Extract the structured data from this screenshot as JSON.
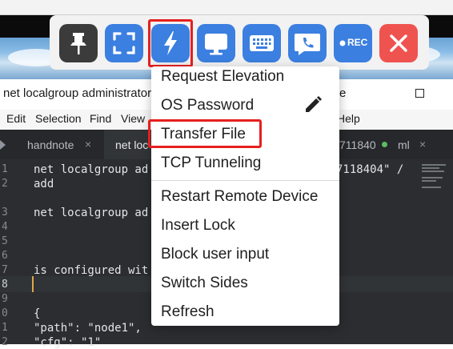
{
  "window": {
    "title": "net localgroup administrators",
    "title_suffix": "e"
  },
  "menubar": {
    "items": [
      "Edit",
      "Selection",
      "Find",
      "View",
      "Help"
    ]
  },
  "tabs": [
    {
      "label": "handnote",
      "close": "×"
    },
    {
      "label": "net loc",
      "active": true
    },
    {
      "label": "711840"
    },
    {
      "label": "ml",
      "close": "×"
    }
  ],
  "editor": {
    "lines": [
      {
        "no": "1",
        "text": "net localgroup ad",
        "tail": "7118404\" /"
      },
      {
        "no": "2",
        "text": "add"
      },
      {
        "no": "3",
        "text": "net localgroup ad"
      },
      {
        "no": "4",
        "text": ""
      },
      {
        "no": "5",
        "text": ""
      },
      {
        "no": "6",
        "text": ""
      },
      {
        "no": "7",
        "text": "is configured wit"
      },
      {
        "no": "8",
        "text": ""
      },
      {
        "no": "9",
        "text": ""
      },
      {
        "no": "0",
        "text": "{"
      },
      {
        "no": "1",
        "text": "\"path\": \"node1\","
      },
      {
        "no": "2",
        "text": "\"cfg\": \"1\""
      }
    ]
  },
  "toolbar": {
    "buttons": [
      {
        "name": "pin",
        "icon": "pin-icon"
      },
      {
        "name": "fullscreen",
        "icon": "fullscreen-icon"
      },
      {
        "name": "actions",
        "icon": "lightning-icon"
      },
      {
        "name": "display",
        "icon": "monitor-icon"
      },
      {
        "name": "keyboard",
        "icon": "keyboard-icon"
      },
      {
        "name": "call",
        "icon": "phone-chat-icon"
      },
      {
        "name": "record",
        "icon": "record-icon",
        "label": "REC"
      },
      {
        "name": "close",
        "icon": "close-icon"
      }
    ],
    "record_label": "REC"
  },
  "dropdown": {
    "items": [
      "Request Elevation",
      "OS Password",
      "Transfer File",
      "TCP Tunneling",
      "Restart Remote Device",
      "Insert Lock",
      "Block user input",
      "Switch Sides",
      "Refresh"
    ]
  },
  "colors": {
    "toolbar_button": "#3b7fe0",
    "close_button": "#ef5350",
    "highlight": "#e5201e",
    "editor_bg": "#2b2d30"
  }
}
